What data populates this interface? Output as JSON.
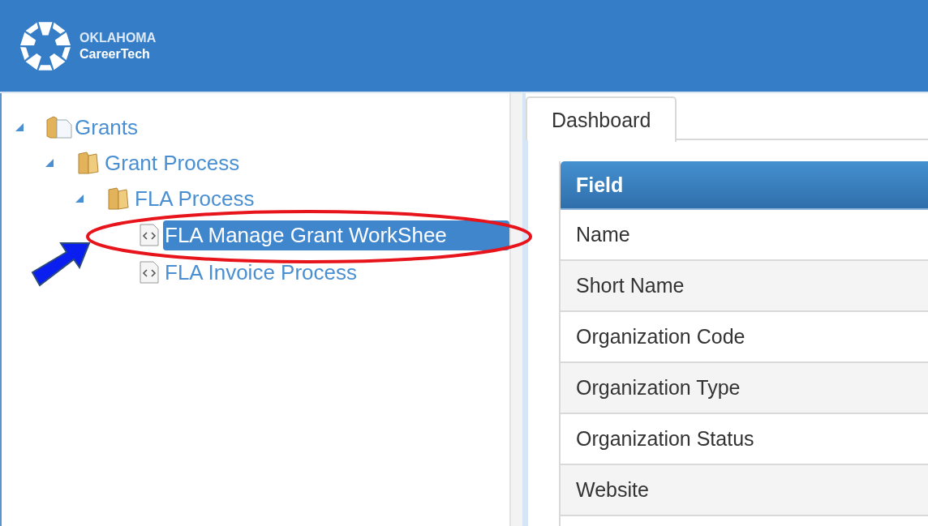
{
  "header": {
    "logo": {
      "line_1": "OKLAHOMA",
      "line_2": "CareerTech"
    }
  },
  "tree": [
    {
      "label": "Grants",
      "kind": "root",
      "expanded": true,
      "selected": false,
      "children": [
        {
          "label": "Grant Process",
          "kind": "folder",
          "expanded": true,
          "selected": false,
          "children": [
            {
              "label": "FLA Process",
              "kind": "folder",
              "expanded": true,
              "selected": false,
              "children": [
                {
                  "label": "FLA Manage Grant WorkShee",
                  "kind": "page",
                  "selected": true
                },
                {
                  "label": "FLA Invoice Process",
                  "kind": "page",
                  "selected": false
                }
              ]
            }
          ]
        }
      ]
    }
  ],
  "tabs": [
    {
      "label": "Dashboard",
      "selected": true
    }
  ],
  "table": {
    "columns": [
      "Field"
    ],
    "rows": [
      "Name",
      "Short Name",
      "Organization Code",
      "Organization Type",
      "Organization Status",
      "Website"
    ]
  }
}
